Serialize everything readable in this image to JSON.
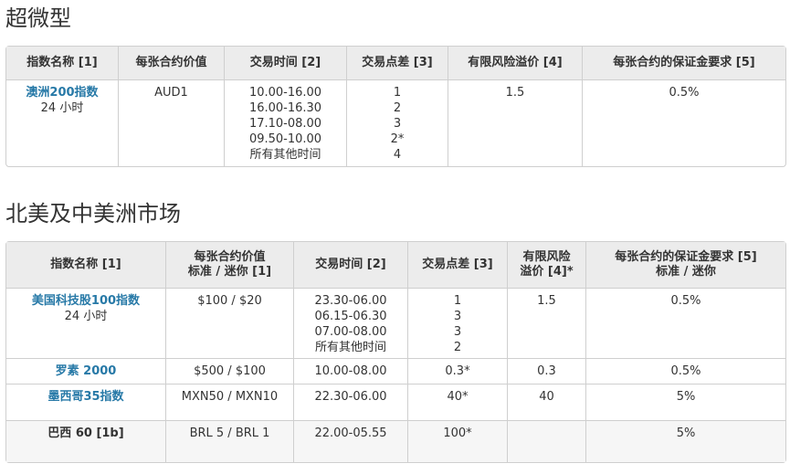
{
  "sections": [
    {
      "title": "超微型",
      "headers": [
        "指数名称 [1]",
        "每张合约价值",
        "交易时间 [2]",
        "交易点差 [3]",
        "有限风险溢价 [4]",
        "每张合约的保证金要求 [5]"
      ],
      "rows": [
        {
          "name": "澳洲200指数",
          "sub": "24 小时",
          "value": "AUD1",
          "hours": [
            "10.00-16.00",
            "16.00-16.30",
            "17.10-08.00",
            "09.50-10.00",
            "所有其他时间"
          ],
          "spreads": [
            "1",
            "2",
            "3",
            "2*",
            "4"
          ],
          "premium": "1.5",
          "margin": "0.5%"
        }
      ]
    },
    {
      "title": "北美及中美洲市场",
      "headers": [
        [
          "指数名称 [1]"
        ],
        [
          "每张合约价值",
          "标准 / 迷你 [1]"
        ],
        [
          "交易时间 [2]"
        ],
        [
          "交易点差 [3]"
        ],
        [
          "有限风险",
          "溢价 [4]*"
        ],
        [
          "每张合约的保证金要求 [5]",
          "标准 / 迷你"
        ]
      ],
      "rows": [
        {
          "name": "美国科技股100指数",
          "sub": "24 小时",
          "value": "$100 / $20",
          "hours": [
            "23.30-06.00",
            "06.15-06.30",
            "07.00-08.00",
            "所有其他时间"
          ],
          "spreads": [
            "1",
            "3",
            "3",
            "2"
          ],
          "premium": "1.5",
          "margin": "0.5%"
        },
        {
          "name": "罗素 2000",
          "value": "$500 / $100",
          "hours": [
            "10.00-08.00"
          ],
          "spreads": [
            "0.3*"
          ],
          "premium": "0.3",
          "margin": "0.5%"
        },
        {
          "name": "墨西哥35指数",
          "value": "MXN50 / MXN10",
          "hours": [
            "22.30-06.00"
          ],
          "spreads": [
            "40*"
          ],
          "premium": "40",
          "margin": "5%"
        },
        {
          "name": "巴西 60 [1b]",
          "value": "BRL 5 / BRL 1",
          "hours": [
            "22.00-05.55"
          ],
          "spreads": [
            "100*"
          ],
          "premium": "",
          "margin": "5%"
        }
      ]
    }
  ],
  "colors": {
    "link": "#2779a7",
    "header_bg": "#ececec",
    "border": "#cfcfcf"
  }
}
